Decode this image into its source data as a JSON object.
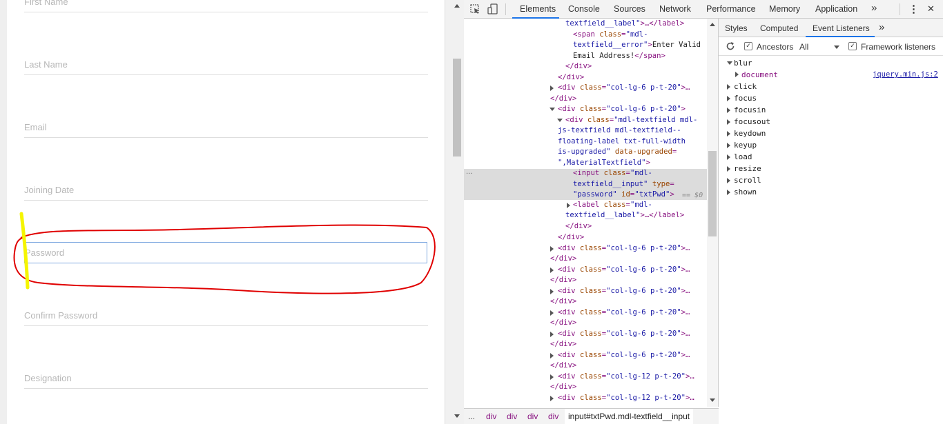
{
  "form": {
    "fields": [
      {
        "label": "First Name"
      },
      {
        "label": "Last Name"
      },
      {
        "label": "Email"
      },
      {
        "label": "Joining Date"
      },
      {
        "label": "Password"
      },
      {
        "label": "Confirm Password"
      },
      {
        "label": "Designation"
      }
    ]
  },
  "devtools": {
    "tabs": [
      "Elements",
      "Console",
      "Sources",
      "Network",
      "Performance",
      "Memory",
      "Application"
    ],
    "more_tabs": "»",
    "menu": "⋮",
    "close": "✕",
    "selected_suffix": "== $0",
    "ellipsis": "···",
    "breadcrumbs": [
      "...",
      "div",
      "div",
      "div",
      "div",
      "input#txtPwd.mdl-textfield__input"
    ]
  },
  "sidebar": {
    "tabs": [
      "Styles",
      "Computed",
      "Event Listeners"
    ],
    "more": "»",
    "ancestors_label": "Ancestors",
    "filter_value": "All",
    "framework_label": "Framework listeners",
    "events": [
      "blur",
      "click",
      "focus",
      "focusin",
      "focusout",
      "keydown",
      "keyup",
      "load",
      "resize",
      "scroll",
      "shown"
    ],
    "blur_child": "document",
    "blur_source": "jquery.min.js:2"
  },
  "colors": {
    "annotation_red": "#e00000",
    "annotation_yellow": "#f5f500",
    "accent_blue": "#1a73e8"
  }
}
